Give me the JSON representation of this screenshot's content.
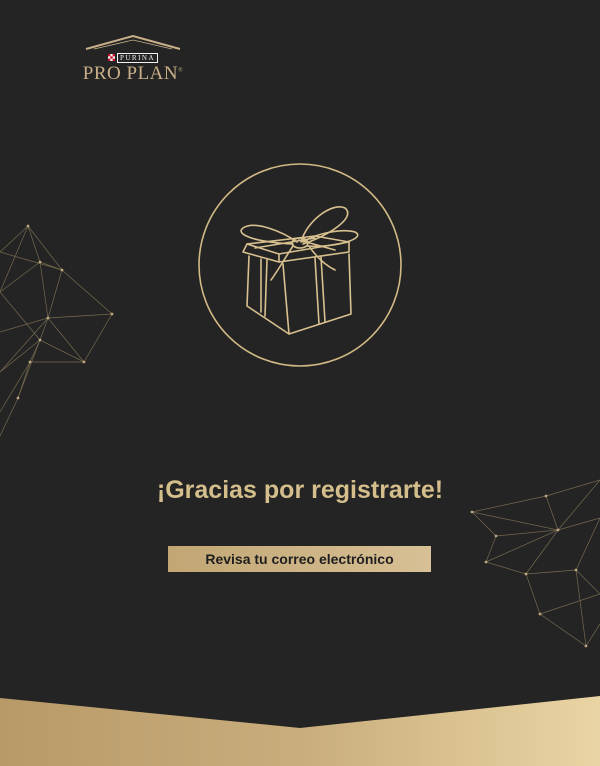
{
  "brand": {
    "small": "PURINA",
    "name": "PRO PLAN",
    "trademark": "®"
  },
  "illustration": {
    "icon": "gift-box-icon"
  },
  "main": {
    "title": "¡Gracias por registrarte!",
    "cta_label": "Revisa tu correo electrónico"
  },
  "colors": {
    "background": "#242424",
    "gold": "#d4be8b",
    "gold_light": "#e7d3a6",
    "gold_dark": "#a98b5c"
  }
}
